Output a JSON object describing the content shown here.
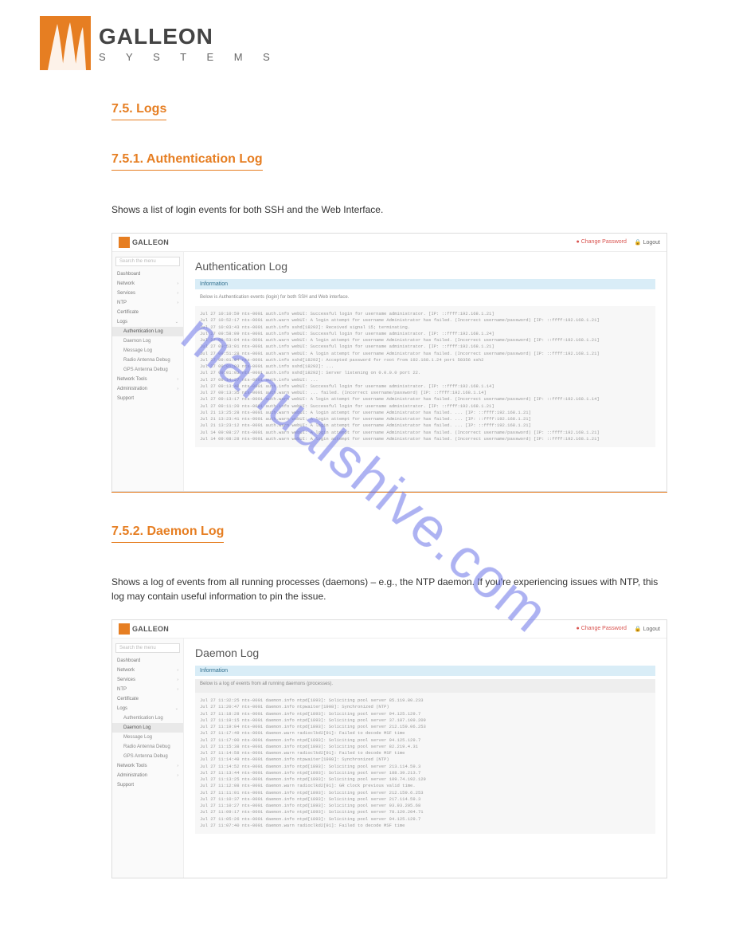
{
  "brand": {
    "name": "GALLEON",
    "tag": "S Y S T E M S"
  },
  "watermark": "manualshive.com",
  "section1": {
    "title": "7.5. Logs",
    "subtitle": "7.5.1. Authentication Log",
    "desc": "Shows a list of login events for both SSH and the Web Interface."
  },
  "section2": {
    "title": "7.5.2. Daemon Log",
    "desc": "Shows a log of events from all running processes (daemons) – e.g., the NTP daemon. If you're experiencing issues with NTP, this log may contain useful information to pin the issue."
  },
  "app": {
    "change_pw": "Change Password",
    "logout": "Logout",
    "search_placeholder": "Search the menu",
    "info_label": "Information",
    "nav": {
      "dashboard": "Dashboard",
      "network": "Network",
      "services": "Services",
      "ntp": "NTP",
      "certificate": "Certificate",
      "logs": "Logs",
      "auth_log": "Authentication Log",
      "daemon_log": "Daemon Log",
      "message_log": "Message Log",
      "radio_debug": "Radio Antenna Debug",
      "gps_debug": "GPS Antenna Debug",
      "network_tools": "Network Tools",
      "administration": "Administration",
      "support": "Support"
    }
  },
  "shot1": {
    "title": "Authentication Log",
    "info_desc": "Below is Authentication events (login) for both SSH and Web interface.",
    "log": "Jul 27 10:10:59 nts-0001 auth.info webUI: Successful login for username administrator. [IP: ::ffff:192.168.1.21]\nJul 27 10:52:17 nts-0001 auth.warn webUI: A login attempt for username Administrator has failed. (Incorrect username/password) [IP: ::ffff:192.168.1.21]\nJul 27 10:03:43 nts-0001 auth.info sshd[18292]: Received signal 15; terminating.\nJul 27 09:58:09 nts-0001 auth.info webUI: Successful login for username administrator. [IP: ::ffff:192.168.1.24]\nJul 27 09:53:04 nts-0001 auth.warn webUI: A login attempt for username Administrator has failed. (Incorrect username/password) [IP: ::ffff:192.168.1.21]\nJul 27 09:53:01 nts-0001 auth.info webUI: Successful login for username administrator. [IP: ::ffff:192.168.1.21]\nJul 27 09:51:28 nts-0001 auth.warn webUI: A login attempt for username Administrator has failed. (Incorrect username/password) [IP: ::ffff:192.168.1.21]\nJul 27 09:01:04 nts-0001 auth.info sshd[18292]: Accepted password for root from 192.168.1.24 port 50356 ssh2\nJul 27 09:01:03 nts-0001 auth.info sshd[18292]: ...\nJul 27 09:01:03 nts-0001 auth.info sshd[18292]: Server listening on 0.0.0.0 port 22.\nJul 27 09:14:27 nts-0001 auth.info webUI: ...\nJul 27 09:13:48 nts-0001 auth.info webUI: Successful login for username administrator. [IP: ::ffff:192.168.1.14]\nJul 27 09:13:35 nts-0001 auth.warn webUI: ... failed. (Incorrect username/password) [IP: ::ffff:192.168.1.14]\nJul 27 09:13:17 nts-0001 auth.warn webUI: A login attempt for username Administrator has failed. (Incorrect username/password) [IP: ::ffff:192.168.1.14]\nJul 27 09:11:20 nts-0001 auth.info webUI: Successful login for username administrator. [IP: ::ffff:192.168.1.21]\nJul 21 13:25:28 nts-0001 auth.warn webUI: A login attempt for username Administrator has failed. ... [IP: ::ffff:192.168.1.21]\nJul 21 13:23:41 nts-0001 auth.warn webUI: A login attempt for username Administrator has failed. ... [IP: ::ffff:192.168.1.21]\nJul 21 13:23:12 nts-0001 auth.warn webUI: A login attempt for username Administrator has failed. ... [IP: ::ffff:192.168.1.21]\nJul 14 09:08:27 nts-0001 auth.warn webUI: A login attempt for username Administrator has failed. (Incorrect username/password) [IP: ::ffff:192.168.1.21]\nJul 14 09:08:28 nts-0001 auth.warn webUI: A login attempt for username Administrator has failed. (Incorrect username/password) [IP: ::ffff:192.168.1.21]"
  },
  "shot2": {
    "title": "Daemon Log",
    "info_desc": "Below is a log of events from all running daemons (processes).",
    "log": "Jul 27 11:32:25 nts-0001 daemon.info ntpd[1893]: Soliciting pool server 85.119.80.233\nJul 27 11:20:47 nts-0001 daemon.info ntpwaiter[1908]: Synchronized (NTP)\nJul 27 11:18:28 nts-0001 daemon.info ntpd[1893]: Soliciting pool server 94.125.129.7\nJul 27 11:19:15 nts-0001 daemon.info ntpd[1893]: Soliciting pool server 37.187.109.209\nJul 27 11:19:04 nts-0001 daemon.info ntpd[1893]: Soliciting pool server 212.159.06.253\nJul 27 11:17:49 nts-0001 daemon.warn radioclkd2[91]: Failed to decode MSF time\nJul 27 11:17:00 nts-0001 daemon.info ntpd[1893]: Soliciting pool server 94.125.129.7\nJul 27 11:15:38 nts-0001 daemon.info ntpd[1893]: Soliciting pool server 82.219.4.31\nJul 27 11:14:58 nts-0001 daemon.warn radioclkd2[91]: Failed to decode MSF time\nJul 27 11:14:49 nts-0001 daemon.info ntpwaiter[1908]: Synchronized (NTP)\nJul 27 11:14:52 nts-0001 daemon.info ntpd[1893]: Soliciting pool server 213.114.59.3\nJul 27 11:13:44 nts-0001 daemon.info ntpd[1893]: Soliciting pool server 188.39.213.7\nJul 27 11:13:25 nts-0001 daemon.info ntpd[1893]: Soliciting pool server 109.74.192.129\nJul 27 11:12:08 nts-0001 daemon.warn radioclkd2[91]: GR clock previous valid time.\nJul 27 11:11:01 nts-0001 daemon.info ntpd[1893]: Soliciting pool server 212.159.6.253\nJul 27 11:10:37 nts-0001 daemon.info ntpd[1893]: Soliciting pool server 217.114.59.3\nJul 27 11:10:27 nts-0001 daemon.info ntpd[1893]: Soliciting pool server 93.93.205.68\nJul 27 11:09:17 nts-0001 daemon.info ntpd[1893]: Soliciting pool server 78.129.204.71\nJul 27 11:05:26 nts-0001 daemon.info ntpd[1893]: Soliciting pool server 94.125.129.7\nJul 27 11:07:40 nts-0001 daemon.warn radioclkd2[91]: Failed to decode MSF time"
  }
}
